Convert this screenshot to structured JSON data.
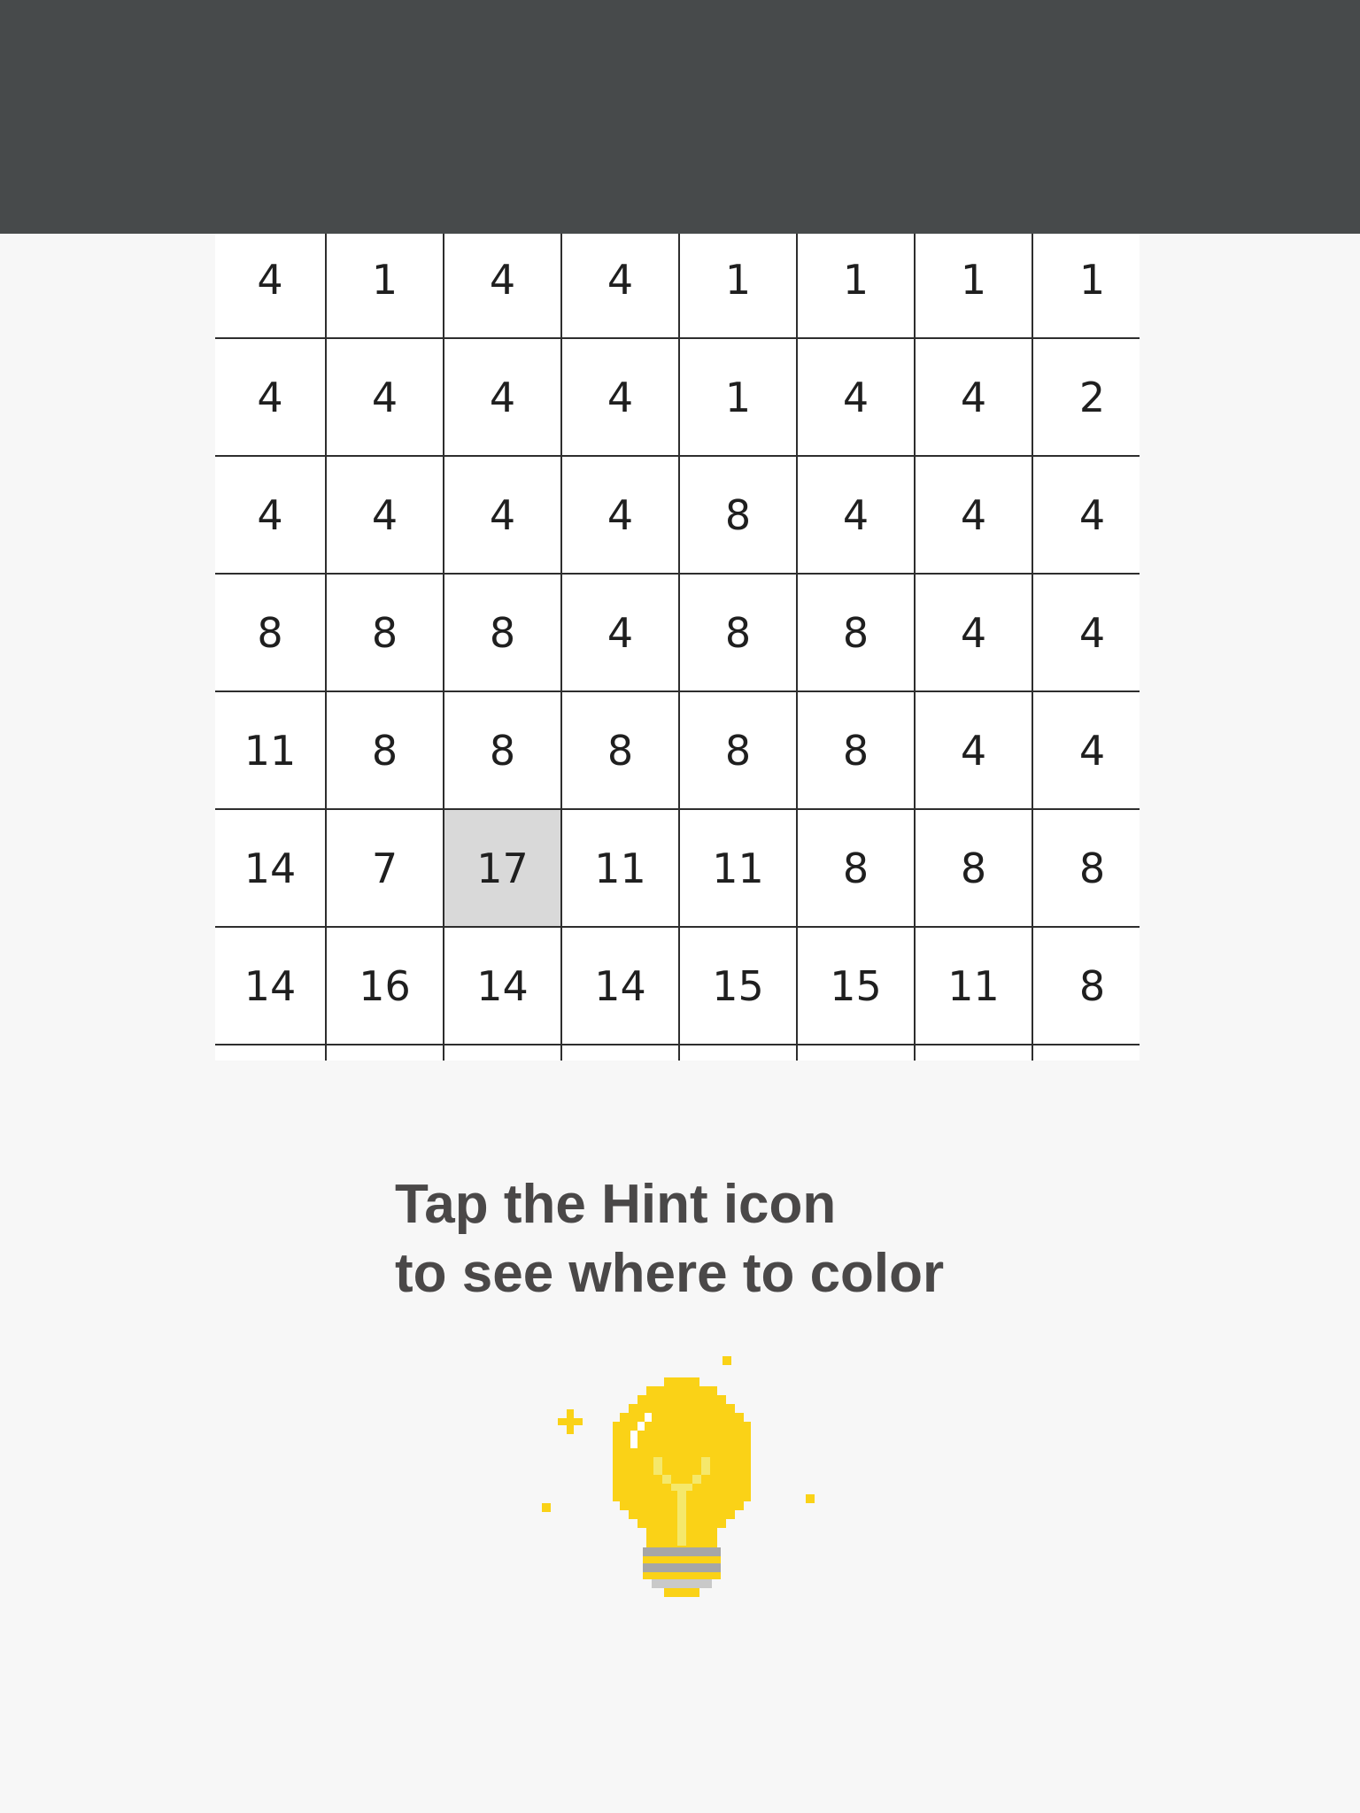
{
  "colors": {
    "top_bar": "#474a4b",
    "background": "#f7f7f7",
    "grid_line": "#2e2e2e",
    "highlight_cell": "#d9d9d9",
    "caption_text": "#4a4848",
    "bulb_yellow": "#fad217",
    "bulb_base": "#a6a6a6"
  },
  "grid": {
    "rows": [
      [
        "4",
        "1",
        "4",
        "4",
        "1",
        "1",
        "1",
        "1"
      ],
      [
        "4",
        "4",
        "4",
        "4",
        "1",
        "4",
        "4",
        "2"
      ],
      [
        "4",
        "4",
        "4",
        "4",
        "8",
        "4",
        "4",
        "4"
      ],
      [
        "8",
        "8",
        "8",
        "4",
        "8",
        "8",
        "4",
        "4"
      ],
      [
        "11",
        "8",
        "8",
        "8",
        "8",
        "8",
        "4",
        "4"
      ],
      [
        "14",
        "7",
        "17",
        "11",
        "11",
        "8",
        "8",
        "8"
      ],
      [
        "14",
        "16",
        "14",
        "14",
        "15",
        "15",
        "11",
        "8"
      ]
    ],
    "highlighted_cell": {
      "row": 5,
      "col": 2
    }
  },
  "caption": {
    "line1": "Tap the Hint icon",
    "line2": "to see where to color"
  },
  "hint_icon": {
    "name": "lightbulb-icon"
  }
}
